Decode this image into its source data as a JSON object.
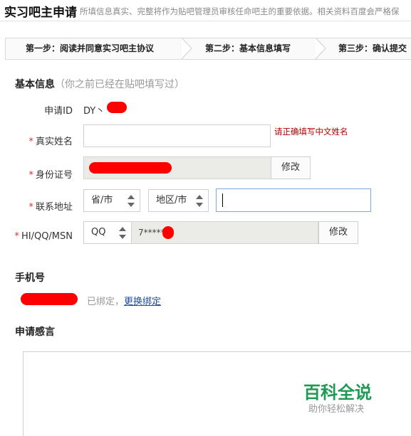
{
  "header": {
    "title": "实习吧主申请",
    "description": "所填信息真实、完整将作为贴吧管理员审核任命吧主的重要依据。相关资料百度会严格保"
  },
  "steps": [
    {
      "label": "第一步：阅读并同意实习吧主协议"
    },
    {
      "label": "第二步：基本信息填写"
    },
    {
      "label": "第三步：确认提交"
    }
  ],
  "basic_info": {
    "title": "基本信息",
    "hint": "（你之前已经在贴吧填写过）",
    "apply_id": {
      "label": "申请ID",
      "value": "DY丶"
    },
    "real_name": {
      "required_mark": "*",
      "label": "真实姓名",
      "value": "",
      "error": "请正确填写中文姓名"
    },
    "id_card": {
      "required_mark": "*",
      "label": "身份证号",
      "edit_button": "修改"
    },
    "address": {
      "required_mark": "*",
      "label": "联系地址",
      "province": "省/市",
      "region": "地区/市",
      "detail": ""
    },
    "im": {
      "required_mark": "*",
      "label": "HI/QQ/MSN",
      "type": "QQ",
      "value": "7*****",
      "edit_button": "修改"
    }
  },
  "phone": {
    "title": "手机号",
    "bound_text": "已绑定，",
    "change_link": "更换绑定"
  },
  "application": {
    "title": "申请感言",
    "text": ""
  },
  "watermark": {
    "title": "百科全说",
    "subtitle": "助你轻松解决"
  },
  "colors": {
    "required": "#e03131",
    "error": "#b50000",
    "link": "#1a4e9b",
    "watermark": "#1e9a55",
    "redaction": "#ff0000"
  }
}
